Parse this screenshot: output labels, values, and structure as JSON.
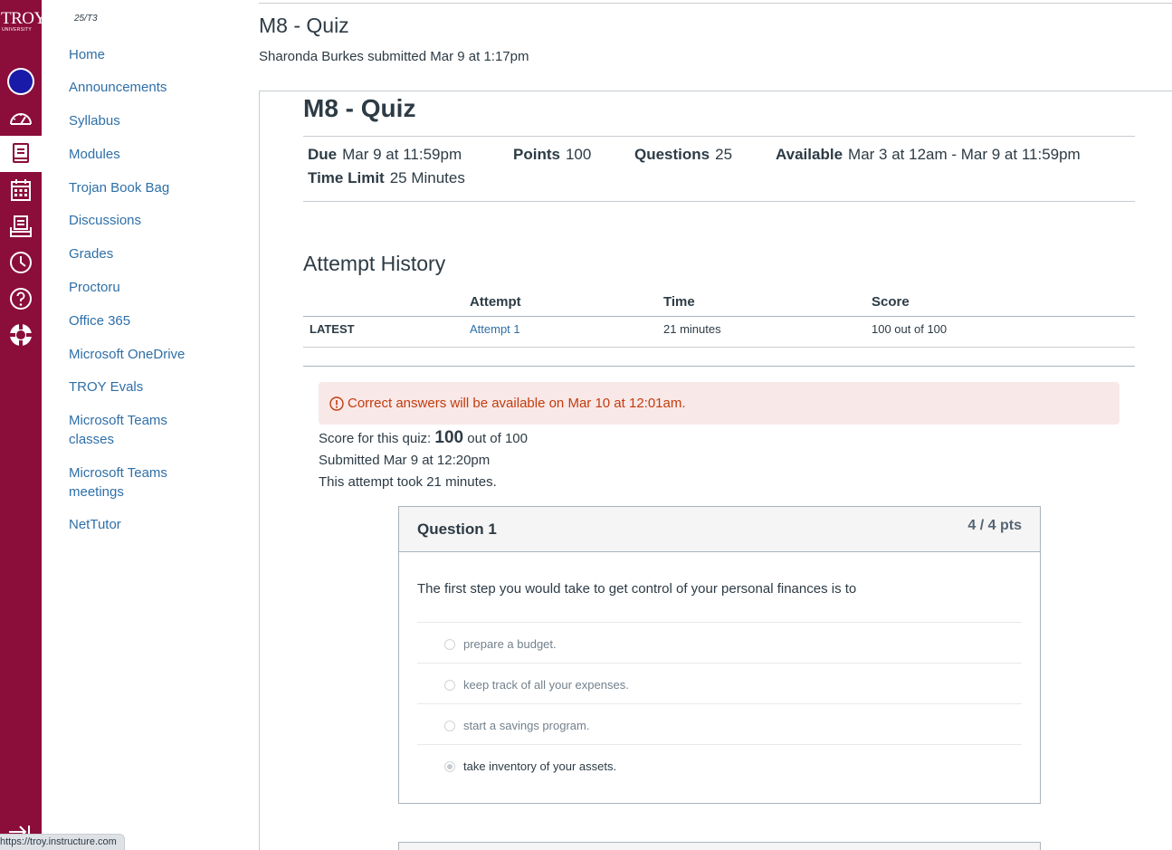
{
  "global_nav": {
    "logo_text": "TROY",
    "logo_subtext": "UNIVERSITY",
    "items": [
      {
        "name": "account"
      },
      {
        "name": "dashboard"
      },
      {
        "name": "courses"
      },
      {
        "name": "calendar"
      },
      {
        "name": "inbox"
      },
      {
        "name": "history"
      },
      {
        "name": "help"
      },
      {
        "name": "troy-resources"
      }
    ],
    "active_item": "courses"
  },
  "course_nav": {
    "term": "25/T3",
    "items": [
      "Home",
      "Announcements",
      "Syllabus",
      "Modules",
      "Trojan Book Bag",
      "Discussions",
      "Grades",
      "Proctoru",
      "Office 365",
      "Microsoft OneDrive",
      "TROY Evals",
      "Microsoft Teams classes",
      "Microsoft Teams meetings",
      "NetTutor"
    ]
  },
  "header": {
    "title": "M8 - Quiz",
    "submitted_by": "Sharonda Burkes submitted Mar 9 at 1:17pm"
  },
  "quiz": {
    "title": "M8 - Quiz",
    "due_label": "Due",
    "due_value": "Mar 9 at 11:59pm",
    "points_label": "Points",
    "points_value": "100",
    "questions_label": "Questions",
    "questions_value": "25",
    "available_label": "Available",
    "available_value": "Mar 3 at 12am - Mar 9 at 11:59pm",
    "time_limit_label": "Time Limit",
    "time_limit_value": "25 Minutes"
  },
  "attempt_history": {
    "heading": "Attempt History",
    "columns": [
      "Attempt",
      "Time",
      "Score"
    ],
    "rows": [
      {
        "label": "LATEST",
        "attempt": "Attempt 1",
        "time": "21 minutes",
        "score": "100 out of 100"
      }
    ]
  },
  "alert": {
    "text": "Correct answers will be available on Mar 10 at 12:01am.",
    "color": "#c23c0d"
  },
  "score_summary": {
    "score_prefix": "Score for this quiz:",
    "score_value": "100",
    "score_suffix": "out of 100",
    "submitted": "Submitted Mar 9 at 12:20pm",
    "duration": "This attempt took 21 minutes."
  },
  "question1": {
    "name": "Question 1",
    "points": "4 / 4 pts",
    "text": "The first step you would take to get control of your personal finances is to",
    "answers": [
      {
        "text": "prepare a budget.",
        "selected": false
      },
      {
        "text": "keep track of all your expenses.",
        "selected": false
      },
      {
        "text": "start a savings program.",
        "selected": false
      },
      {
        "text": "take inventory of your assets.",
        "selected": true
      }
    ]
  },
  "status_bar": {
    "url": "https://troy.instructure.com"
  },
  "colors": {
    "brand": "#8b0d3a",
    "link": "#2e6fa8",
    "text": "#2d3b45"
  }
}
